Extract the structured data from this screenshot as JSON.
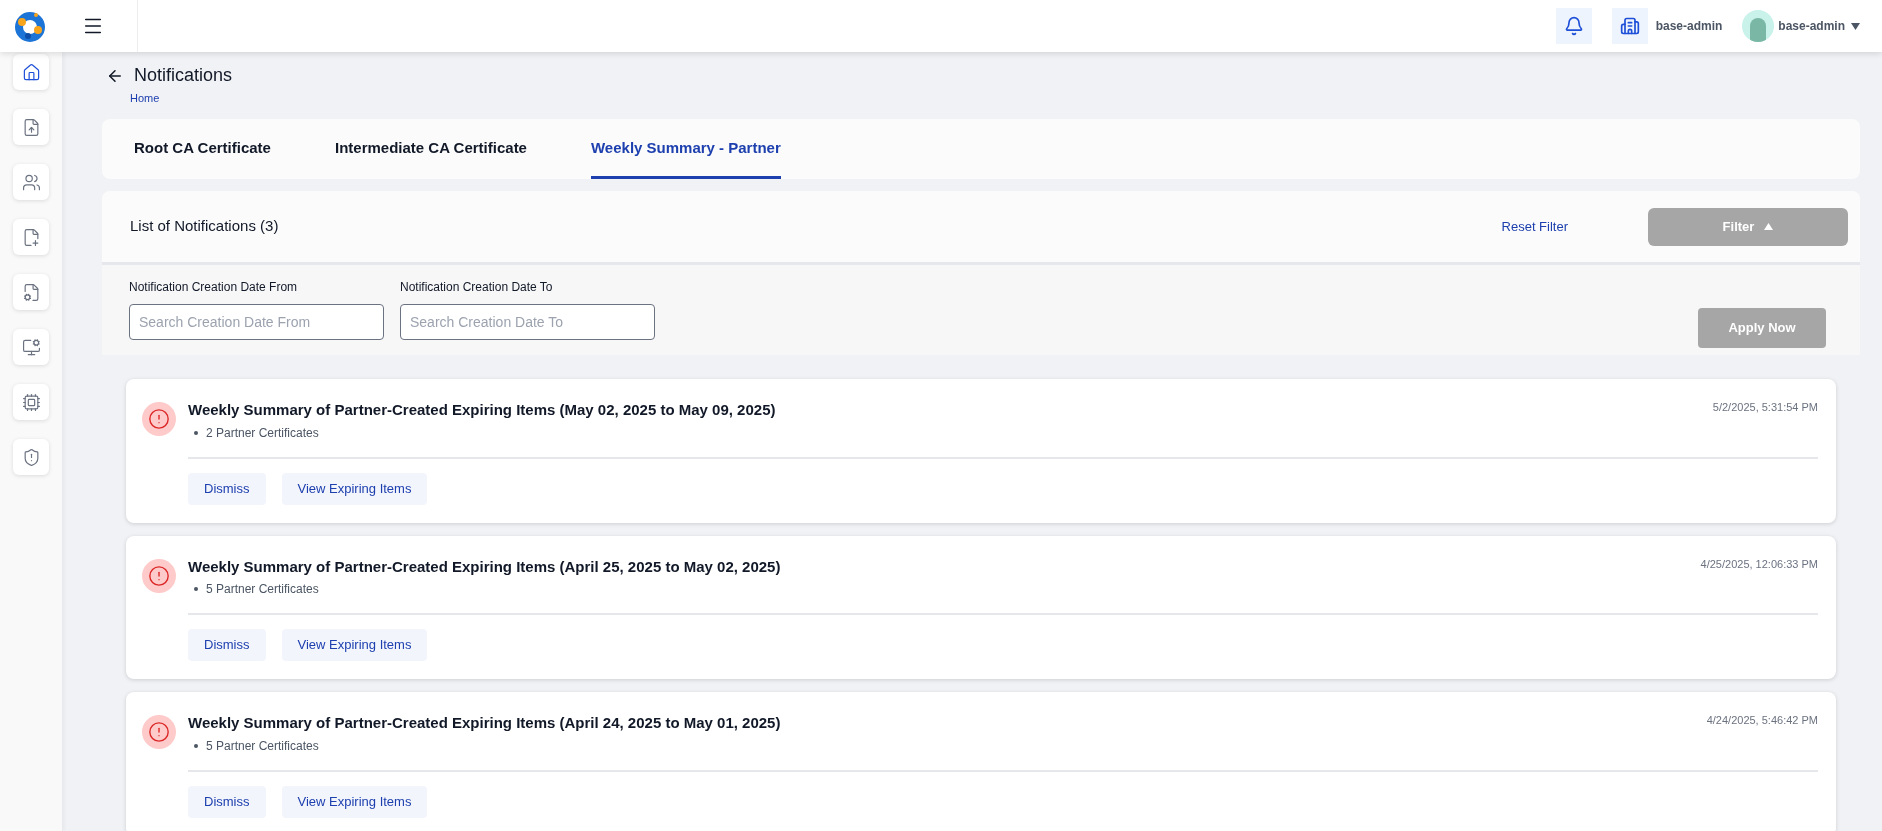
{
  "header": {
    "org_name": "base-admin",
    "user_name": "base-admin"
  },
  "sidebar": {
    "items": [
      {
        "kind": "home",
        "selected": true
      },
      {
        "kind": "upload",
        "selected": false
      },
      {
        "kind": "users",
        "selected": false
      },
      {
        "kind": "list-add",
        "selected": false
      },
      {
        "kind": "list-settings",
        "selected": false
      },
      {
        "kind": "monitor-gear",
        "selected": false
      },
      {
        "kind": "chip",
        "selected": false
      },
      {
        "kind": "shield",
        "selected": false
      }
    ]
  },
  "page": {
    "title": "Notifications",
    "breadcrumb": "Home"
  },
  "tabs": [
    {
      "label": "Root CA Certificate",
      "selected": false
    },
    {
      "label": "Intermediate CA Certificate",
      "selected": false
    },
    {
      "label": "Weekly Summary - Partner",
      "selected": true
    }
  ],
  "list": {
    "title": "List of Notifications (3)",
    "reset_filter": "Reset Filter",
    "filter_button": "Filter",
    "filter_expanded": true
  },
  "filters": {
    "fields": [
      {
        "label": "Notification Creation Date From",
        "placeholder": "Search Creation Date From"
      },
      {
        "label": "Notification Creation Date To",
        "placeholder": "Search Creation Date To"
      }
    ],
    "apply_button": "Apply Now"
  },
  "notifications": [
    {
      "title": "Weekly Summary of Partner-Created Expiring Items (May 02, 2025 to May 09, 2025)",
      "items": [
        "2 Partner Certificates"
      ],
      "time": "5/2/2025, 5:31:54 PM",
      "actions": [
        "Dismiss",
        "View Expiring Items"
      ]
    },
    {
      "title": "Weekly Summary of Partner-Created Expiring Items (April 25, 2025 to May 02, 2025)",
      "items": [
        "5 Partner Certificates"
      ],
      "time": "4/25/2025, 12:06:33 PM",
      "actions": [
        "Dismiss",
        "View Expiring Items"
      ]
    },
    {
      "title": "Weekly Summary of Partner-Created Expiring Items (April 24, 2025 to May 01, 2025)",
      "items": [
        "5 Partner Certificates"
      ],
      "time": "4/24/2025, 5:46:42 PM",
      "actions": [
        "Dismiss",
        "View Expiring Items"
      ]
    }
  ]
}
